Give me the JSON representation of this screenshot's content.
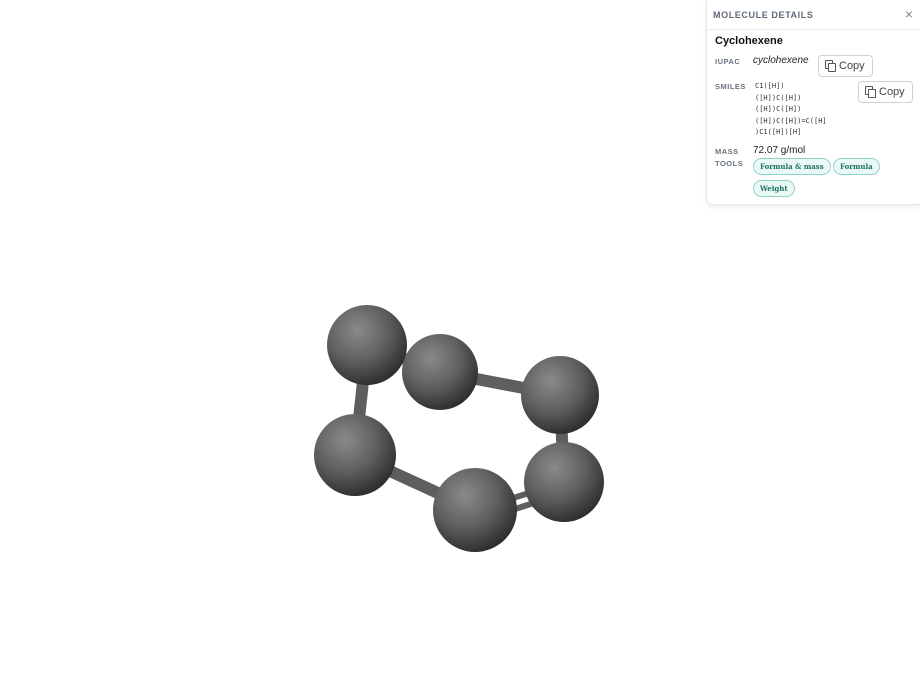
{
  "panel": {
    "title": "MOLECULE DETAILS",
    "close_glyph": "×",
    "molecule_name": "Cyclohexene",
    "iupac_label": "IUPAC",
    "iupac_value": "cyclohexene",
    "smiles_label": "SMILES",
    "smiles_lines": [
      "C1([H])",
      "([H])C([H])",
      "([H])C([H])",
      "([H])C([H])=C([H]",
      ")C1([H])[H]"
    ],
    "mass_label": "MASS",
    "mass_value": "72.07 g/mol",
    "tools_label": "TOOLS",
    "copy_label": "Copy",
    "tools": [
      "Formula & mass",
      "Formula",
      "Weight"
    ]
  },
  "viewer": {
    "atom_color": "#5c5c5c",
    "bond_color": "#666666",
    "accent_color": "#1d6f5f"
  }
}
